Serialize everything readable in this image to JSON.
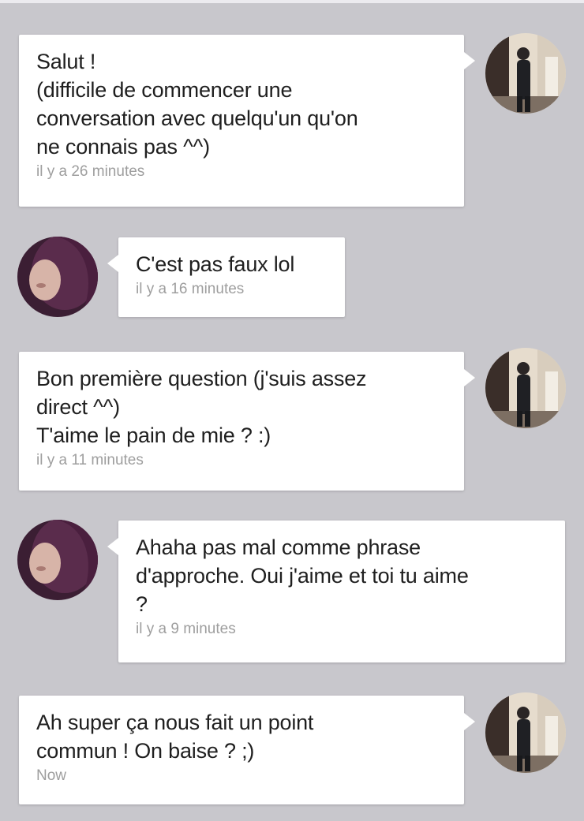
{
  "messages": [
    {
      "sender": "him",
      "text": "Salut !\n(difficile de commencer une\nconversation avec quelqu'un qu'on\nne connais pas ^^)",
      "time": "il y a 26 minutes"
    },
    {
      "sender": "her",
      "text": "C'est pas faux lol",
      "time": "il y a 16 minutes"
    },
    {
      "sender": "him",
      "text": "Bon première question (j'suis assez\ndirect ^^)\nT'aime le pain de mie ? :)",
      "time": "il y a 11 minutes"
    },
    {
      "sender": "her",
      "text": "Ahaha pas mal comme phrase\nd'approche. Oui j'aime et toi tu aime\n?",
      "time": "il y a 9 minutes"
    },
    {
      "sender": "him",
      "text": "Ah super ça nous fait un point\ncommun ! On baise ? ;)",
      "time": "Now"
    }
  ],
  "colors": {
    "background": "#c8c7cc",
    "bubble": "#ffffff",
    "text": "#1f1f1f",
    "timestamp": "#9e9e9e"
  },
  "icons": {
    "him": "avatar-photo-man",
    "her": "avatar-photo-woman"
  }
}
